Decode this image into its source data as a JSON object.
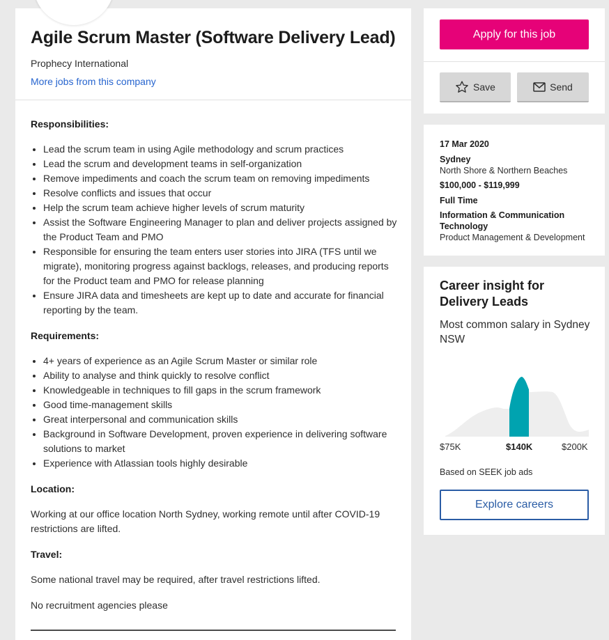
{
  "job": {
    "title": "Agile Scrum Master (Software Delivery Lead)",
    "company": "Prophecy International",
    "more_jobs_link": "More jobs from this company"
  },
  "description": {
    "responsibilities_heading": "Responsibilities:",
    "responsibilities": [
      "Lead the scrum team in using Agile methodology and scrum practices",
      "Lead the scrum and development teams in self-organization",
      "Remove impediments and coach the scrum team on removing impediments",
      "Resolve conflicts and issues that occur",
      "Help the scrum team achieve higher levels of scrum maturity",
      "Assist the Software Engineering Manager to plan and deliver projects assigned by the Product Team and PMO",
      "Responsible for ensuring the team enters user stories into JIRA (TFS until we migrate), monitoring progress against backlogs, releases, and producing reports for the Product team and PMO for release planning",
      "Ensure JIRA data and timesheets are kept up to date and accurate for financial reporting by the team."
    ],
    "requirements_heading": "Requirements:",
    "requirements": [
      "4+ years of experience as an Agile Scrum Master or similar role",
      "Ability to analyse and think quickly to resolve conflict",
      "Knowledgeable in techniques to fill gaps in the scrum framework",
      "Good time-management skills",
      "Great interpersonal and communication skills",
      "Background in Software Development, proven experience in delivering software solutions to market",
      "Experience with Atlassian tools highly desirable"
    ],
    "location_heading": "Location:",
    "location_text": "Working at our office location North Sydney, working remote until after COVID-19 restrictions are lifted.",
    "travel_heading": "Travel:",
    "travel_text": "Some national travel may be required, after travel restrictions lifted.",
    "agencies_text": "No recruitment agencies please"
  },
  "actions": {
    "apply_label": "Apply for this job",
    "save_label": "Save",
    "send_label": "Send",
    "save_icon": "star-icon",
    "send_icon": "envelope-icon"
  },
  "details": {
    "date": "17 Mar 2020",
    "city": "Sydney",
    "area": "North Shore & Northern Beaches",
    "salary": "$100,000 - $119,999",
    "work_type": "Full Time",
    "classification": "Information & Communication Technology",
    "sub_classification": "Product Management & Development"
  },
  "insight": {
    "title": "Career insight for Delivery Leads",
    "subtitle": "Most common salary in Sydney NSW",
    "min_label": "$75K",
    "mode_label": "$140K",
    "max_label": "$200K",
    "source_note": "Based on SEEK job ads",
    "explore_label": "Explore careers"
  },
  "chart_data": {
    "type": "area",
    "x_labels": [
      "$75K",
      "$140K",
      "$200K"
    ],
    "highlighted_bin": "$140K",
    "colors": {
      "distribution": "#eeeeee",
      "highlight": "#00a3b0"
    }
  },
  "colors": {
    "apply": "#e60278",
    "link": "#2765cf",
    "explore": "#2a5ca5"
  }
}
